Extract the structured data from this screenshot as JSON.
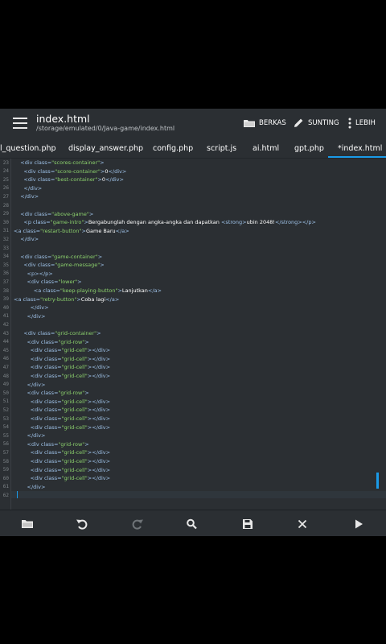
{
  "header": {
    "title": "index.html",
    "path": "/storage/emulated/0/Java-game/index.html",
    "actions": [
      {
        "label": "BERKAS",
        "icon": "folder-icon"
      },
      {
        "label": "SUNTING",
        "icon": "pencil-icon"
      },
      {
        "label": "LEBIH",
        "icon": "more-vertical-icon"
      }
    ]
  },
  "tabs": [
    {
      "label": "l_question.php"
    },
    {
      "label": "display_answer.php"
    },
    {
      "label": "config.php"
    },
    {
      "label": "script.js"
    },
    {
      "label": "ai.html"
    },
    {
      "label": "gpt.php"
    },
    {
      "label": "*index.html",
      "active": true
    }
  ],
  "editor": {
    "lines": [
      {
        "n": "23",
        "s": [
          [
            "t",
            "    <div class="
          ],
          [
            "s",
            "\"scores-container\""
          ],
          [
            "t",
            ">"
          ]
        ]
      },
      {
        "n": "24",
        "s": [
          [
            "t",
            "      <div class="
          ],
          [
            "s",
            "\"score-container\""
          ],
          [
            "t",
            ">"
          ],
          [
            "x",
            "0"
          ],
          [
            "t",
            "</div>"
          ]
        ]
      },
      {
        "n": "25",
        "s": [
          [
            "t",
            "      <div class="
          ],
          [
            "s",
            "\"best-container\""
          ],
          [
            "t",
            ">"
          ],
          [
            "x",
            "0"
          ],
          [
            "t",
            "</div>"
          ]
        ]
      },
      {
        "n": "26",
        "s": [
          [
            "t",
            "      </div>"
          ]
        ]
      },
      {
        "n": "27",
        "s": [
          [
            "t",
            "    </div>"
          ]
        ]
      },
      {
        "n": "28",
        "s": []
      },
      {
        "n": "29",
        "s": [
          [
            "t",
            "    <div class="
          ],
          [
            "s",
            "\"above-game\""
          ],
          [
            "t",
            ">"
          ]
        ]
      },
      {
        "n": "30",
        "s": [
          [
            "t",
            "      <p class="
          ],
          [
            "s",
            "\"game-intro\""
          ],
          [
            "t",
            ">"
          ],
          [
            "x",
            "Bergabunglah dengan angka-angka dan dapatkan "
          ],
          [
            "t",
            "<strong>"
          ],
          [
            "x",
            "ubin 2048!"
          ],
          [
            "t",
            "</strong></p>"
          ]
        ]
      },
      {
        "n": "31",
        "s": [
          [
            "t",
            "<a class="
          ],
          [
            "s",
            "\"restart-button\""
          ],
          [
            "t",
            ">"
          ],
          [
            "x",
            "Game Baru"
          ],
          [
            "t",
            "</a>"
          ]
        ]
      },
      {
        "n": "32",
        "s": [
          [
            "t",
            "    </div>"
          ]
        ]
      },
      {
        "n": "33",
        "s": []
      },
      {
        "n": "34",
        "s": [
          [
            "t",
            "    <div class="
          ],
          [
            "s",
            "\"game-container\""
          ],
          [
            "t",
            ">"
          ]
        ]
      },
      {
        "n": "35",
        "s": [
          [
            "t",
            "      <div class="
          ],
          [
            "s",
            "\"game-message\""
          ],
          [
            "t",
            ">"
          ]
        ]
      },
      {
        "n": "36",
        "s": [
          [
            "t",
            "        <p></p>"
          ]
        ]
      },
      {
        "n": "37",
        "s": [
          [
            "t",
            "        <div class="
          ],
          [
            "s",
            "\"lower\""
          ],
          [
            "t",
            ">"
          ]
        ]
      },
      {
        "n": "38",
        "s": [
          [
            "t",
            "            <a class="
          ],
          [
            "s",
            "\"keep-playing-button\""
          ],
          [
            "t",
            ">"
          ],
          [
            "x",
            "Lanjutkan"
          ],
          [
            "t",
            "</a>"
          ]
        ]
      },
      {
        "n": "39",
        "s": [
          [
            "t",
            "<a class="
          ],
          [
            "s",
            "\"retry-button\""
          ],
          [
            "t",
            ">"
          ],
          [
            "x",
            "Coba lagi"
          ],
          [
            "t",
            "</a>"
          ]
        ]
      },
      {
        "n": "40",
        "s": [
          [
            "t",
            "          </div>"
          ]
        ]
      },
      {
        "n": "41",
        "s": [
          [
            "t",
            "        </div>"
          ]
        ]
      },
      {
        "n": "42",
        "s": []
      },
      {
        "n": "43",
        "s": [
          [
            "t",
            "      <div class="
          ],
          [
            "s",
            "\"grid-container\""
          ],
          [
            "t",
            ">"
          ]
        ]
      },
      {
        "n": "44",
        "s": [
          [
            "t",
            "        <div class="
          ],
          [
            "s",
            "\"grid-row\""
          ],
          [
            "t",
            ">"
          ]
        ]
      },
      {
        "n": "45",
        "s": [
          [
            "t",
            "          <div class="
          ],
          [
            "s",
            "\"grid-cell\""
          ],
          [
            "t",
            "></div>"
          ]
        ]
      },
      {
        "n": "46",
        "s": [
          [
            "t",
            "          <div class="
          ],
          [
            "s",
            "\"grid-cell\""
          ],
          [
            "t",
            "></div>"
          ]
        ]
      },
      {
        "n": "47",
        "s": [
          [
            "t",
            "          <div class="
          ],
          [
            "s",
            "\"grid-cell\""
          ],
          [
            "t",
            "></div>"
          ]
        ]
      },
      {
        "n": "48",
        "s": [
          [
            "t",
            "          <div class="
          ],
          [
            "s",
            "\"grid-cell\""
          ],
          [
            "t",
            "></div>"
          ]
        ]
      },
      {
        "n": "49",
        "s": [
          [
            "t",
            "        </div>"
          ]
        ]
      },
      {
        "n": "50",
        "s": [
          [
            "t",
            "        <div class="
          ],
          [
            "s",
            "\"grid-row\""
          ],
          [
            "t",
            ">"
          ]
        ]
      },
      {
        "n": "51",
        "s": [
          [
            "t",
            "          <div class="
          ],
          [
            "s",
            "\"grid-cell\""
          ],
          [
            "t",
            "></div>"
          ]
        ]
      },
      {
        "n": "52",
        "s": [
          [
            "t",
            "          <div class="
          ],
          [
            "s",
            "\"grid-cell\""
          ],
          [
            "t",
            "></div>"
          ]
        ]
      },
      {
        "n": "53",
        "s": [
          [
            "t",
            "          <div class="
          ],
          [
            "s",
            "\"grid-cell\""
          ],
          [
            "t",
            "></div>"
          ]
        ]
      },
      {
        "n": "54",
        "s": [
          [
            "t",
            "          <div class="
          ],
          [
            "s",
            "\"grid-cell\""
          ],
          [
            "t",
            "></div>"
          ]
        ]
      },
      {
        "n": "55",
        "s": [
          [
            "t",
            "        </div>"
          ]
        ]
      },
      {
        "n": "56",
        "s": [
          [
            "t",
            "        <div class="
          ],
          [
            "s",
            "\"grid-row\""
          ],
          [
            "t",
            ">"
          ]
        ]
      },
      {
        "n": "57",
        "s": [
          [
            "t",
            "          <div class="
          ],
          [
            "s",
            "\"grid-cell\""
          ],
          [
            "t",
            "></div>"
          ]
        ]
      },
      {
        "n": "58",
        "s": [
          [
            "t",
            "          <div class="
          ],
          [
            "s",
            "\"grid-cell\""
          ],
          [
            "t",
            "></div>"
          ]
        ]
      },
      {
        "n": "59",
        "s": [
          [
            "t",
            "          <div class="
          ],
          [
            "s",
            "\"grid-cell\""
          ],
          [
            "t",
            "></div>"
          ]
        ]
      },
      {
        "n": "60",
        "s": [
          [
            "t",
            "          <div class="
          ],
          [
            "s",
            "\"grid-cell\""
          ],
          [
            "t",
            "></div>"
          ]
        ]
      },
      {
        "n": "61",
        "s": [
          [
            "t",
            "        </div>"
          ]
        ]
      },
      {
        "n": "62",
        "s": []
      }
    ]
  },
  "toolbar": [
    {
      "icon": "folder-open-icon"
    },
    {
      "icon": "undo-icon"
    },
    {
      "icon": "redo-icon",
      "disabled": true
    },
    {
      "icon": "search-icon"
    },
    {
      "icon": "save-icon"
    },
    {
      "icon": "close-icon"
    },
    {
      "icon": "run-icon"
    }
  ],
  "colors": {
    "background": "#2b2f33",
    "accent": "#1a9be8",
    "tag": "#9ec2e8",
    "string": "#8bd06c",
    "text": "#ffffff"
  }
}
